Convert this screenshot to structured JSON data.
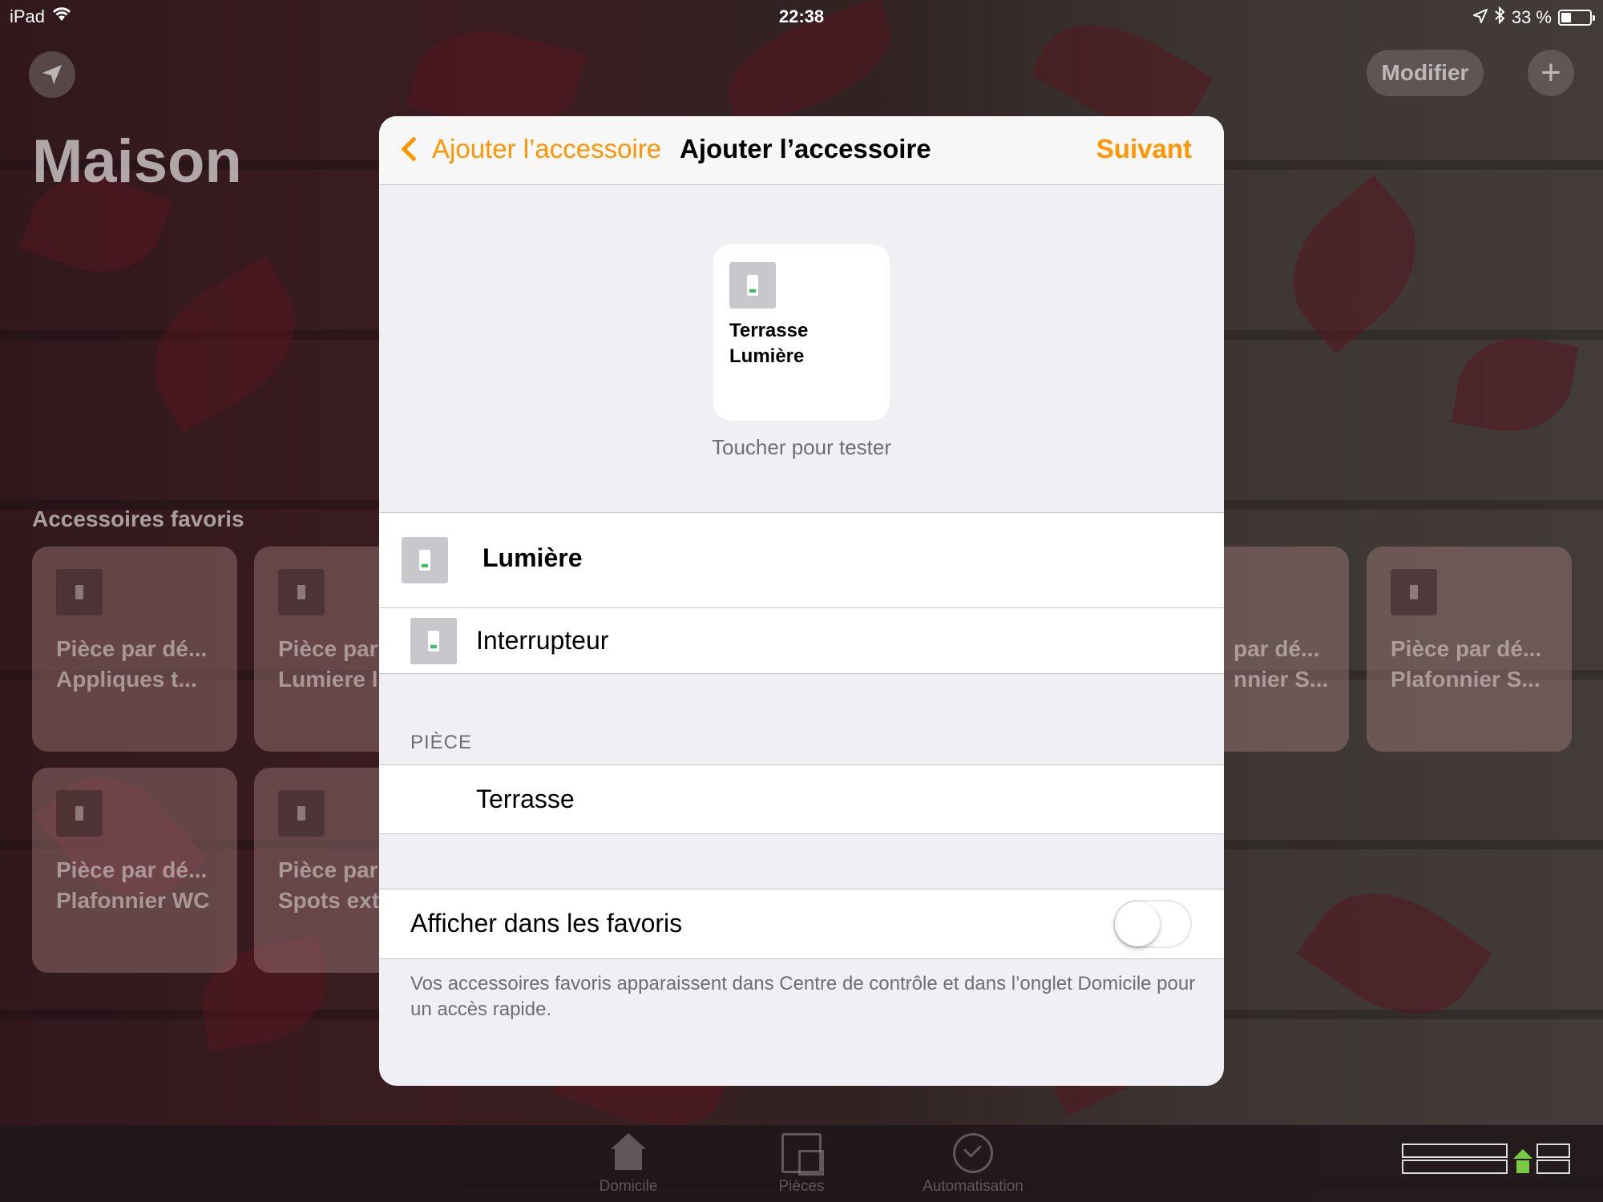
{
  "status_bar": {
    "carrier": "iPad",
    "time": "22:38",
    "battery_text": "33 %"
  },
  "home": {
    "title": "Maison",
    "modify_label": "Modifier",
    "add_label": "+",
    "favorites_title": "Accessoires favoris",
    "tiles": [
      {
        "line1": "Pièce par dé...",
        "line2": "Appliques t..."
      },
      {
        "line1": "Pièce par",
        "line2": "Lumiere l"
      },
      {
        "line1": "par dé...",
        "line2": "nnier S..."
      },
      {
        "line1": "Pièce par dé...",
        "line2": "Plafonnier S..."
      },
      {
        "line1": "Pièce par dé...",
        "line2": "Plafonnier WC"
      },
      {
        "line1": "Pièce par",
        "line2": "Spots ext"
      }
    ]
  },
  "tabbar": {
    "tabs": [
      {
        "label": "Domicile"
      },
      {
        "label": "Pièces"
      },
      {
        "label": "Automatisation"
      }
    ]
  },
  "modal": {
    "back_label": "Ajouter l’accessoire",
    "title": "Ajouter l’accessoire",
    "next_label": "Suivant",
    "preview": {
      "line1": "Terrasse",
      "line2": "Lumière",
      "hint": "Toucher pour tester"
    },
    "accessory": {
      "name": "Lumière",
      "service": "Interrupteur"
    },
    "room": {
      "header": "PIÈCE",
      "value": "Terrasse"
    },
    "favorites": {
      "label": "Afficher dans les favoris",
      "enabled": false,
      "note": "Vos accessoires favoris apparaissent dans Centre de contrôle et dans l’onglet Domicile pour un accès rapide."
    }
  },
  "colors": {
    "accent": "#ff9500",
    "grouped_background": "#efeff4",
    "separator": "#c8c7cc",
    "secondary_text": "#6d6d72",
    "switch_indicator": "#34c759"
  }
}
